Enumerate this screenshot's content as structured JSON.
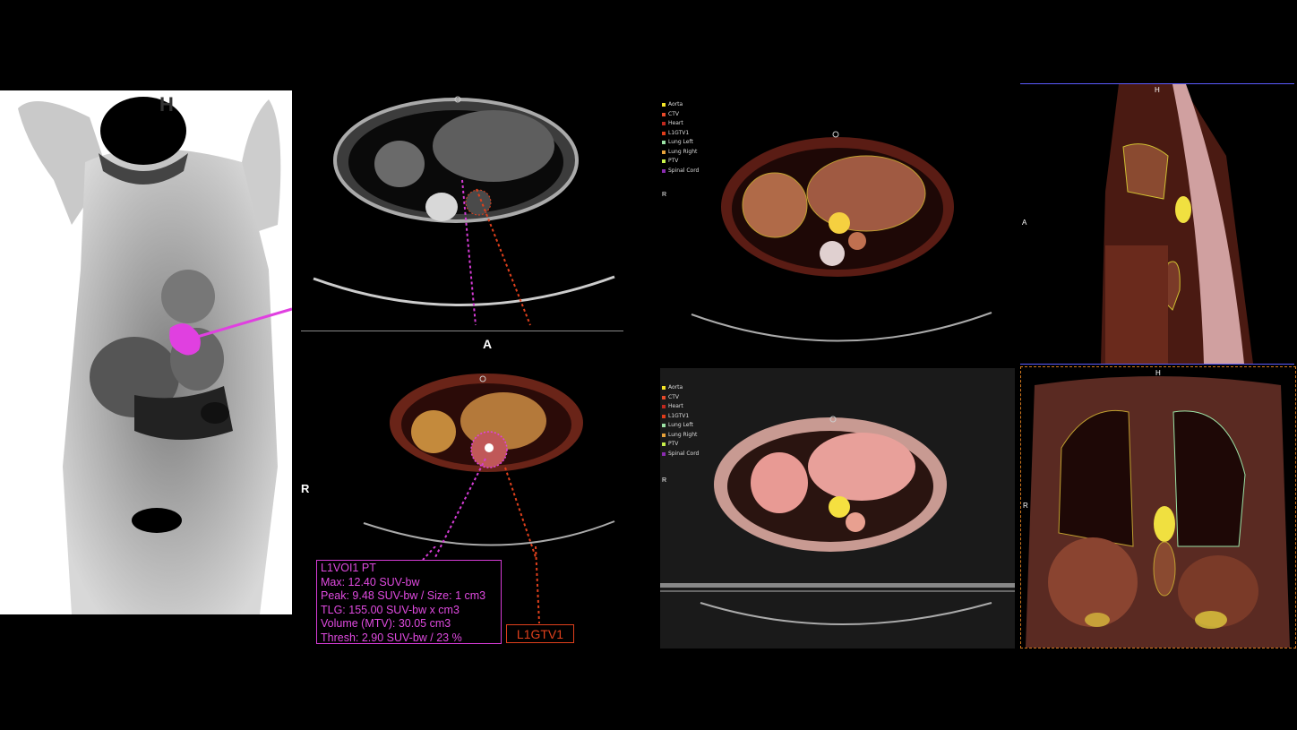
{
  "viewports": {
    "mip": {
      "orientation_label": "H"
    },
    "ct_axial": {
      "orientation_label": "A"
    },
    "fusion_axial": {
      "orientation_label": "R"
    },
    "fusion_axial_2": {
      "orientation_label": "R"
    },
    "fusion_axial_3": {
      "orientation_label": "R"
    },
    "sagittal": {
      "top_label": "H",
      "side_label": "A"
    },
    "coronal": {
      "top_label": "H",
      "side_label": "R"
    }
  },
  "legend": [
    {
      "name": "Aorta",
      "color": "#f5e626"
    },
    {
      "name": "CTV",
      "color": "#e84a2a"
    },
    {
      "name": "Heart",
      "color": "#c0281e"
    },
    {
      "name": "L1GTV1",
      "color": "#e03c1a"
    },
    {
      "name": "Lung Left",
      "color": "#9be3a6"
    },
    {
      "name": "Lung Right",
      "color": "#e8a23a"
    },
    {
      "name": "PTV",
      "color": "#c8f24a"
    },
    {
      "name": "Spinal Cord",
      "color": "#8a2bb0"
    }
  ],
  "voi_stats": {
    "title": "L1VOI1 PT",
    "max": "Max: 12.40 SUV-bw",
    "peak": "Peak: 9.48 SUV-bw / Size: 1 cm3",
    "tlg": "TLG: 155.00 SUV-bw x cm3",
    "volume": "Volume (MTV): 30.05 cm3",
    "thresh": "Thresh: 2.90 SUV-bw / 23 %"
  },
  "gtv_label": "L1GTV1",
  "colors": {
    "voi_magenta": "#d63cd6",
    "gtv_red": "#e0401c",
    "frame_blue": "#5b5bff",
    "frame_orange": "#d2781e"
  }
}
